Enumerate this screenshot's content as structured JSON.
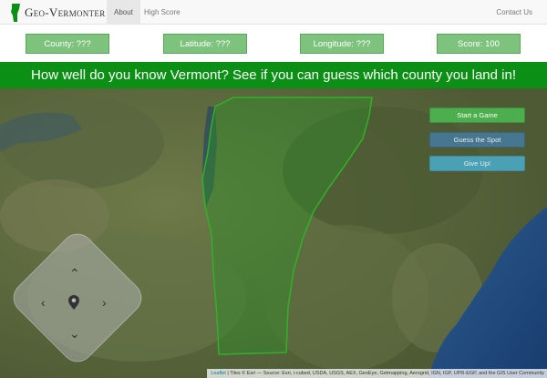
{
  "nav": {
    "brand": "Geo-Vermonter",
    "about": "About",
    "high_score": "High Score",
    "contact": "Contact Us"
  },
  "stats": {
    "county": "County: ???",
    "latitude": "Latitude: ???",
    "longitude": "Longitude: ???",
    "score": "Score: 100"
  },
  "banner": "How well do you know Vermont? See if you can guess which county you land in!",
  "map": {
    "buttons": {
      "start": "Start a Game",
      "guess": "Guess the Spot",
      "give_up": "Give Up!"
    },
    "pan_icons": [
      "chevron-up-icon",
      "chevron-left-icon",
      "chevron-right-icon",
      "chevron-down-icon",
      "location-pin-icon"
    ],
    "attribution": {
      "leaflet": "Leaflet",
      "tiles": "| Tiles © Esri — Source: Esri, i-cubed, USDA, USGS, AEX, GeoEye, Getmapping, Aerogrid, IGN, IGP, UPR-EGP, and the GIS User Community"
    }
  },
  "colors": {
    "banner": "#0b8f15",
    "stat_box": "#7dc27d",
    "start_button": "#4cae4c",
    "guess_button": "#46799a",
    "give_up_button": "#4aa8c2"
  }
}
